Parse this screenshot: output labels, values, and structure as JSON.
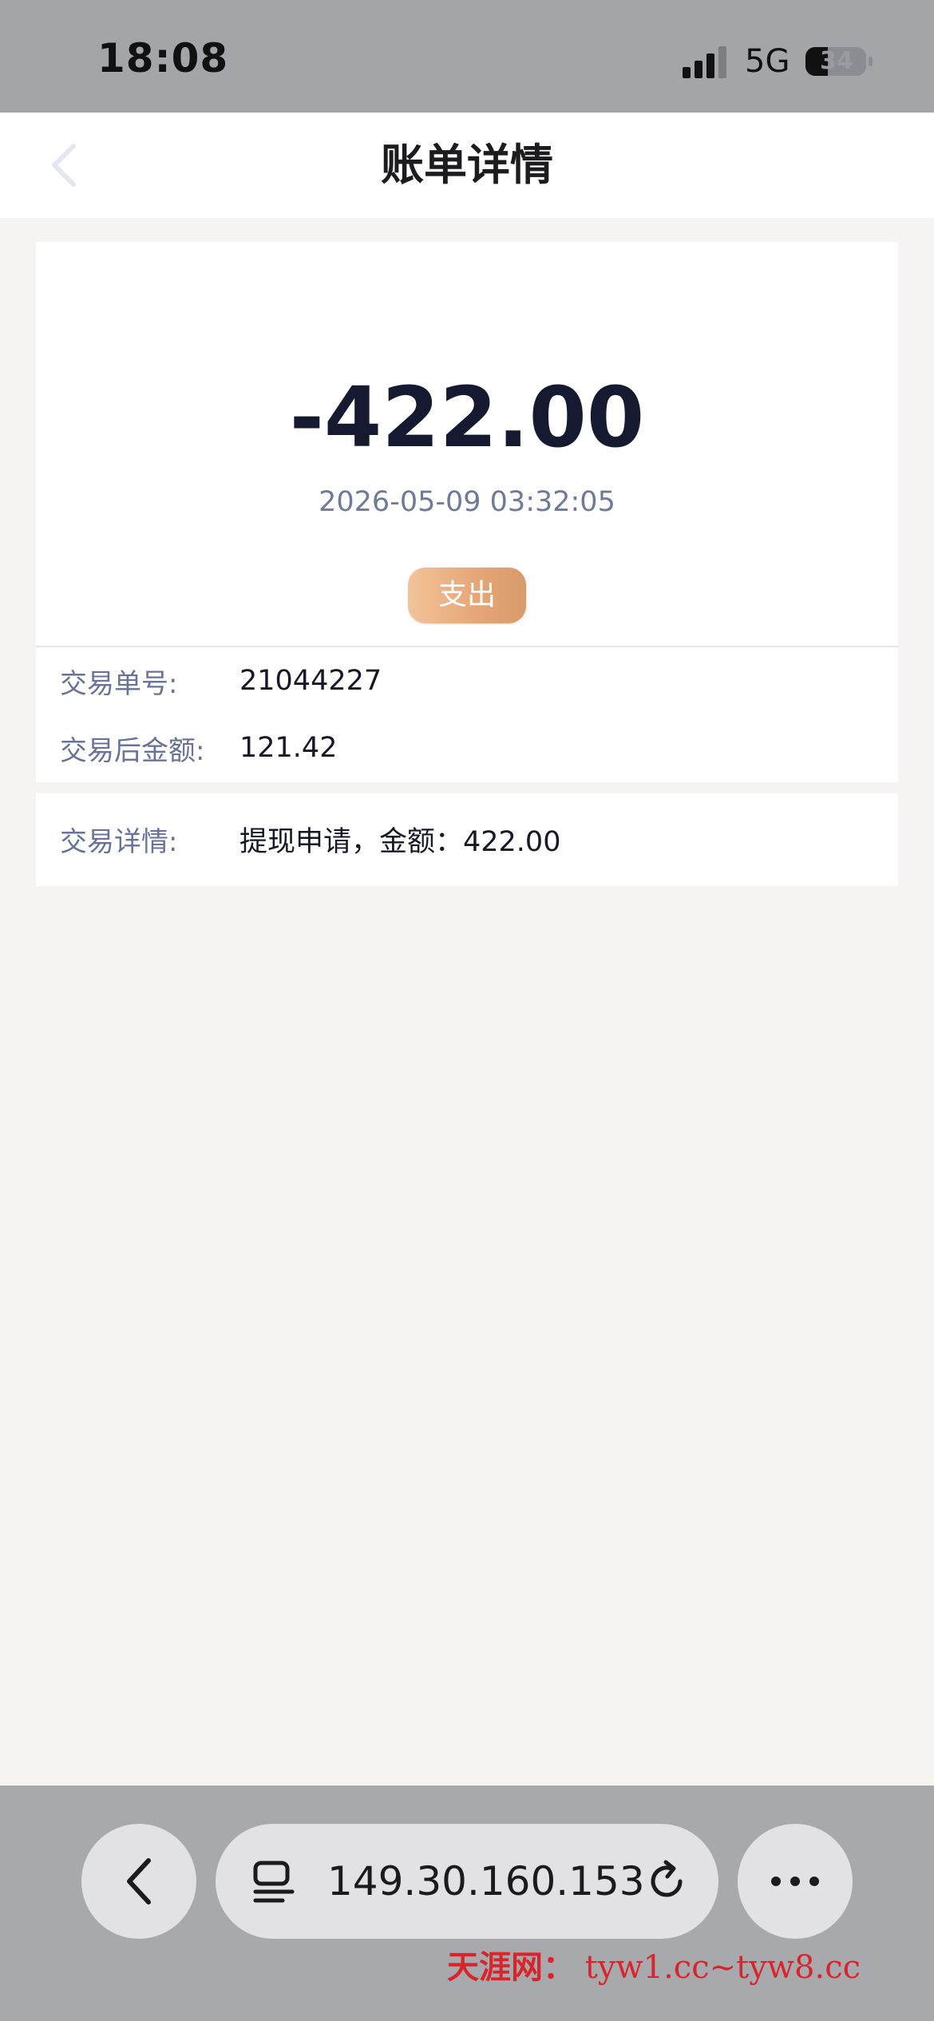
{
  "status_bar": {
    "time": "18:08",
    "network": "5G",
    "battery": "34"
  },
  "nav": {
    "title": "账单详情",
    "back_icon": "chevron-left-icon"
  },
  "summary": {
    "amount": "-422.00",
    "datetime": "2026-05-09 03:32:05",
    "type_badge": "支出"
  },
  "info": {
    "rows": [
      {
        "label": "交易单号:",
        "value": "21044227"
      },
      {
        "label": "交易后金额:",
        "value": "121.42"
      }
    ]
  },
  "details": {
    "label": "交易详情:",
    "value": "提现申请，金额：422.00"
  },
  "browser": {
    "url": "149.30.160.153",
    "back_icon": "chevron-left-icon",
    "reader_icon": "reader-mode-icon",
    "reload_icon": "reload-icon",
    "more_icon": "ellipsis-icon"
  },
  "watermark": {
    "name": "天涯网：",
    "urls": "tyw1.cc~tyw8.cc"
  },
  "colors": {
    "badge_gradient_start": "#f2c39a",
    "badge_gradient_end": "#d99a6c",
    "label_color": "#68729a",
    "amount_color": "#161a31",
    "watermark_color": "#d8242a"
  }
}
